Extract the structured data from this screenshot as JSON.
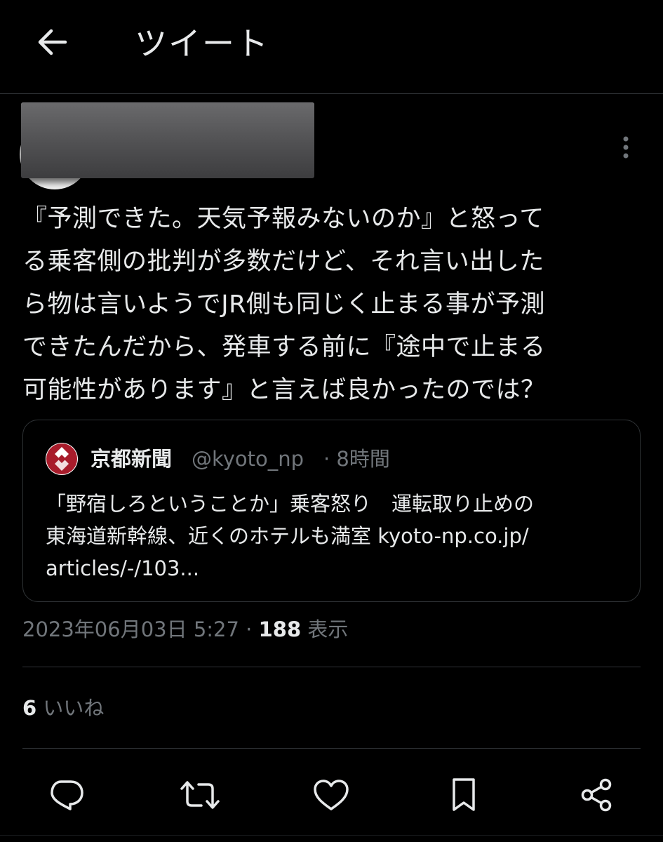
{
  "header": {
    "title": "ツイート",
    "back_icon": "arrow-left-icon"
  },
  "tweet": {
    "text": "『予測できた。天気予報みないのか』と怒って\nる乗客側の批判が多数だけど、それ言い出した\nら物は言いようでJR側も同じく止まる事が予測\nできたんだから、発車する前に『途中で止まる\n可能性があります』と言えば良かったのでは？",
    "more_icon": "more-vertical-icon"
  },
  "quote": {
    "name": "京都新聞",
    "handle": "@kyoto_np",
    "time": "· 8時間",
    "text": "「野宿しろということか」乗客怒り　運転取り止めの\n東海道新幹線、近くのホテルも満室 kyoto-np.co.jp/\narticles/-/103...",
    "logo_color": "#a81c2b"
  },
  "meta": {
    "datetime": "2023年06月03日 5:27 · ",
    "views_count": "188",
    "views_label": " 表示"
  },
  "stats": {
    "likes_count": "6",
    "likes_label": " いいね"
  },
  "actions": {
    "reply_icon": "reply-icon",
    "retweet_icon": "retweet-icon",
    "like_icon": "heart-icon",
    "bookmark_icon": "bookmark-icon",
    "share_icon": "share-icon"
  },
  "colors": {
    "background": "#000000",
    "text": "#e7e9ea",
    "secondary_text": "#71767b",
    "border": "#2f3336"
  }
}
